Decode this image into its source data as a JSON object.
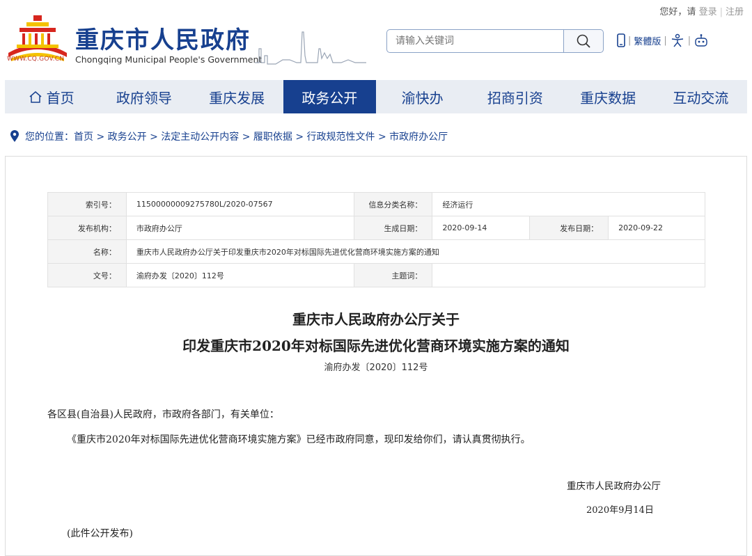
{
  "header": {
    "greeting": "您好，请",
    "login": "登录",
    "register": "注册",
    "site_title": "重庆市人民政府",
    "site_subtitle": "Chongqing Municipal People's Government",
    "site_url": "WWW.CQ.GOV.CN",
    "search_placeholder": "请输入关键词",
    "traditional_label": "繁體版"
  },
  "nav": {
    "items": [
      "首页",
      "政府领导",
      "重庆发展",
      "政务公开",
      "渝快办",
      "招商引资",
      "重庆数据",
      "互动交流"
    ],
    "active": "政务公开"
  },
  "breadcrumb": {
    "prefix": "您的位置：",
    "path": "首页 > 政务公开 > 法定主动公开内容 > 履职依据 > 行政规范性文件 > 市政府办公厅"
  },
  "info": {
    "index_label": "索引号：",
    "index_value": "11500000009275780L/2020-07567",
    "category_label": "信息分类名称：",
    "category_value": "经济运行",
    "issuer_label": "发布机构：",
    "issuer_value": "市政府办公厅",
    "created_label": "生成日期：",
    "created_value": "2020-09-14",
    "published_label": "发布日期：",
    "published_value": "2020-09-22",
    "name_label": "名称：",
    "name_value": "重庆市人民政府办公厅关于印发重庆市2020年对标国际先进优化营商环境实施方案的通知",
    "docno_label": "文号：",
    "docno_value": "渝府办发〔2020〕112号",
    "subject_label": "主题词：",
    "subject_value": ""
  },
  "document": {
    "title_line1": "重庆市人民政府办公厅关于",
    "title_line2": "印发重庆市2020年对标国际先进优化营商环境实施方案的通知",
    "doc_number": "渝府办发〔2020〕112号",
    "addressee": "各区县(自治县)人民政府，市政府各部门，有关单位：",
    "paragraph": "《重庆市2020年对标国际先进优化营商环境实施方案》已经市政府同意，现印发给你们，请认真贯彻执行。",
    "signer": "重庆市人民政府办公厅",
    "date": "2020年9月14日",
    "note": "(此件公开发布)"
  },
  "colors": {
    "brand_blue": "#17408f",
    "nav_bg": "#e9edf3",
    "emblem_red": "#d7261e",
    "emblem_yellow": "#f4c200"
  }
}
